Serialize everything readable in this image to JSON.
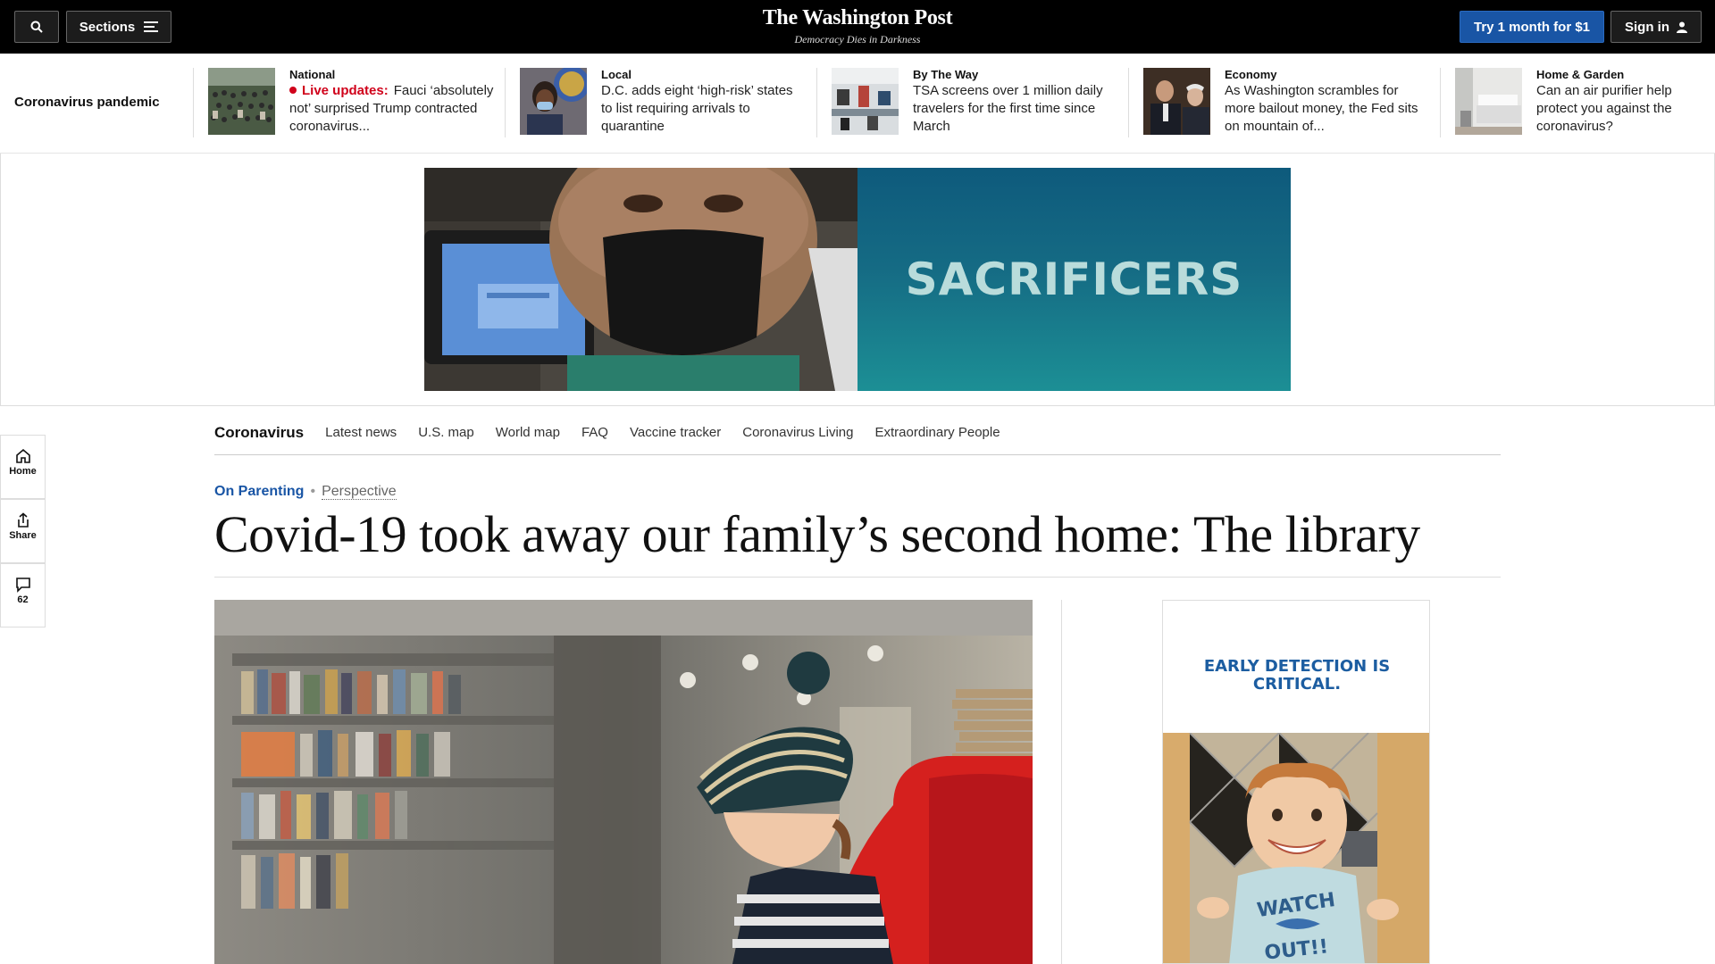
{
  "header": {
    "sections_label": "Sections",
    "logo": "The Washington Post",
    "tagline": "Democracy Dies in Darkness",
    "subscribe_label": "Try 1 month for $1",
    "signin_label": "Sign in"
  },
  "headline_strip": {
    "label": "Coronavirus pandemic",
    "items": [
      {
        "kicker": "National",
        "live_label": "Live updates:",
        "headline": "Fauci ‘absolutely not’ surprised Trump contracted coronavirus..."
      },
      {
        "kicker": "Local",
        "headline": "D.C. adds eight ‘high-risk’ states to list requiring arrivals to quarantine"
      },
      {
        "kicker": "By The Way",
        "headline": "TSA screens over 1 million daily travelers for the first time since March"
      },
      {
        "kicker": "Economy",
        "headline": "As Washington scrambles for more bailout money, the Fed sits on mountain of..."
      },
      {
        "kicker": "Home & Garden",
        "headline": "Can an air purifier help protect you against the coronavirus?"
      }
    ]
  },
  "ad_banner": {
    "text": "SACRIFICERS"
  },
  "left_rail": {
    "home_label": "Home",
    "share_label": "Share",
    "comments_count": "62"
  },
  "subnav": {
    "title": "Coronavirus",
    "links": [
      "Latest news",
      "U.S. map",
      "World map",
      "FAQ",
      "Vaccine tracker",
      "Coronavirus Living",
      "Extraordinary People"
    ]
  },
  "article": {
    "kicker_parent": "On Parenting",
    "kicker_label": "Perspective",
    "headline": "Covid-19 took away our family’s second home: The library"
  },
  "side_ad": {
    "text": "EARLY DETECTION IS CRITICAL."
  },
  "colors": {
    "brand_blue": "#1955a5",
    "live_red": "#d0021b",
    "ad_teal": "#156b84"
  }
}
